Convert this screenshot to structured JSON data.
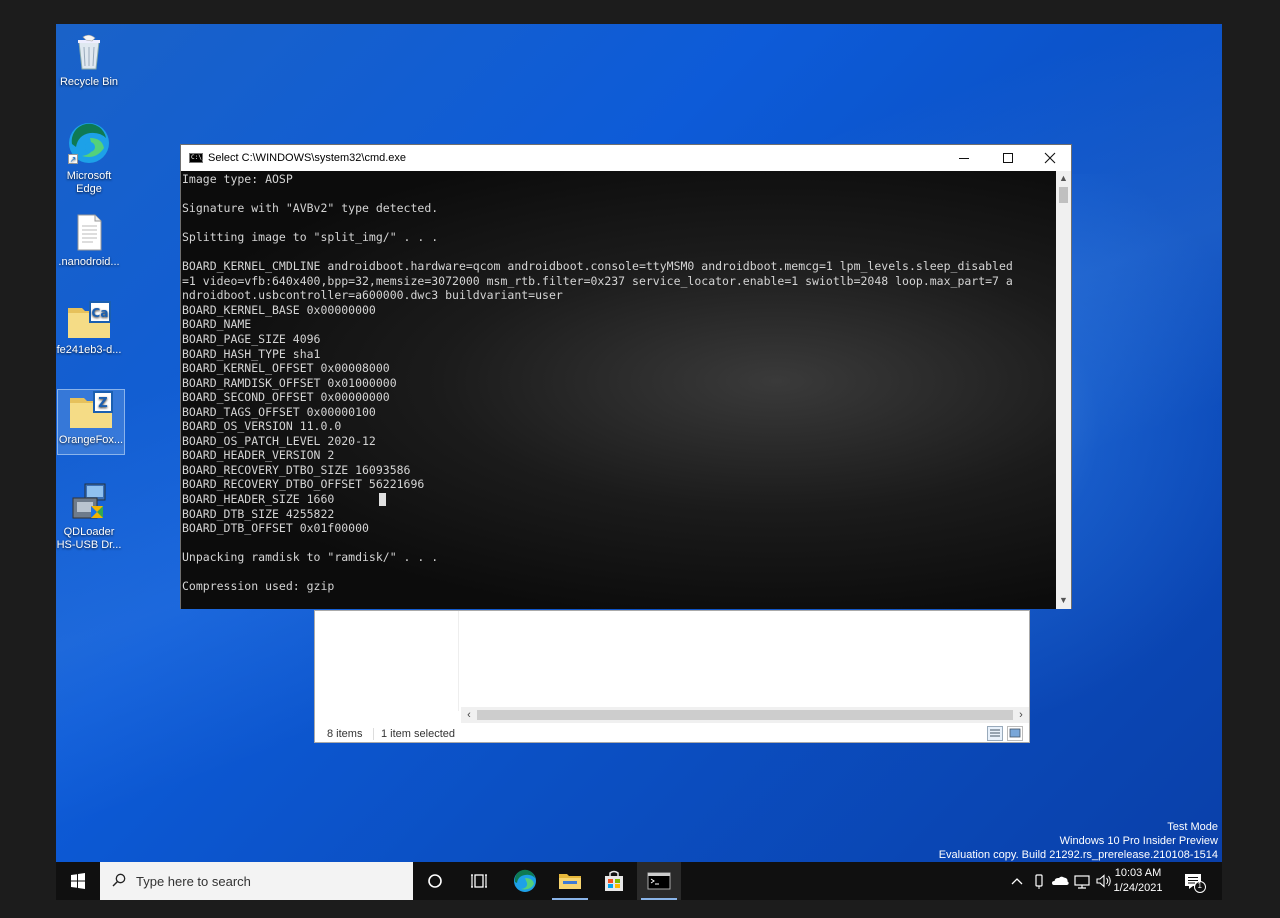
{
  "desktop": {
    "icons": [
      {
        "label": "Recycle Bin"
      },
      {
        "label": "Microsoft Edge"
      },
      {
        "label": ".nanodroid..."
      },
      {
        "label": "fe241eb3-d..."
      },
      {
        "label": "OrangeFox..."
      },
      {
        "label": "QDLoader HS-USB Dr..."
      }
    ]
  },
  "cmd": {
    "title": "Select C:\\WINDOWS\\system32\\cmd.exe",
    "icon_text": "C:\\_",
    "lines": [
      "Image type: AOSP",
      "",
      "Signature with \"AVBv2\" type detected.",
      "",
      "Splitting image to \"split_img/\" . . .",
      "",
      "BOARD_KERNEL_CMDLINE androidboot.hardware=qcom androidboot.console=ttyMSM0 androidboot.memcg=1 lpm_levels.sleep_disabled",
      "=1 video=vfb:640x400,bpp=32,memsize=3072000 msm_rtb.filter=0x237 service_locator.enable=1 swiotlb=2048 loop.max_part=7 a",
      "ndroidboot.usbcontroller=a600000.dwc3 buildvariant=user",
      "BOARD_KERNEL_BASE 0x00000000",
      "BOARD_NAME",
      "BOARD_PAGE_SIZE 4096",
      "BOARD_HASH_TYPE sha1",
      "BOARD_KERNEL_OFFSET 0x00008000",
      "BOARD_RAMDISK_OFFSET 0x01000000",
      "BOARD_SECOND_OFFSET 0x00000000",
      "BOARD_TAGS_OFFSET 0x00000100",
      "BOARD_OS_VERSION 11.0.0",
      "BOARD_OS_PATCH_LEVEL 2020-12",
      "BOARD_HEADER_VERSION 2",
      "BOARD_RECOVERY_DTBO_SIZE 16093586",
      "BOARD_RECOVERY_DTBO_OFFSET 56221696",
      "BOARD_HEADER_SIZE 1660",
      "BOARD_DTB_SIZE 4255822",
      "BOARD_DTB_OFFSET 0x01f00000",
      "",
      "Unpacking ramdisk to \"ramdisk/\" . . .",
      "",
      "Compression used: gzip"
    ]
  },
  "explorer": {
    "status_items": "8 items",
    "status_selected": "1 item selected"
  },
  "watermark": {
    "line1": "Test Mode",
    "line2": "Windows 10 Pro Insider Preview",
    "line3": "Evaluation copy. Build 21292.rs_prerelease.210108-1514"
  },
  "taskbar": {
    "search_placeholder": "Type here to search",
    "time": "10:03 AM",
    "date": "1/24/2021",
    "notification_count": "1"
  },
  "colors": {
    "desktop_blue": "#0d5bd8",
    "taskbar": "#101010",
    "console_text": "#d4d4d4"
  }
}
